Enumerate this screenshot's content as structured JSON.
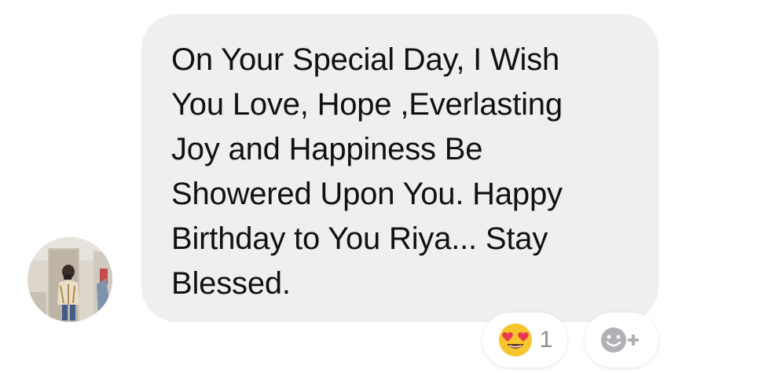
{
  "message": {
    "text": "On Your Special Day, I Wish\nYou Love, Hope ,Everlasting\nJoy and Happiness Be\nShowered Upon You. Happy\nBirthday to You Riya... Stay\nBlessed."
  },
  "reactions": {
    "emoji_icon": "heart-eyes-emoji-icon",
    "count": "1",
    "add_icon": "add-reaction-icon"
  },
  "colors": {
    "bubble": "#efeff1",
    "text": "#111111",
    "count": "#8e8e93",
    "add_icon": "#b0b0b5"
  }
}
